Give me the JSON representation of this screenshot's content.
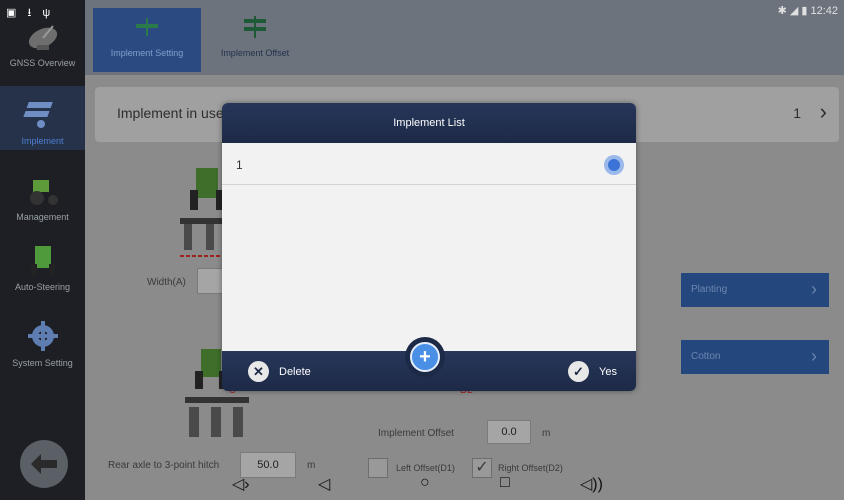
{
  "status_bar": {
    "left_icons": "▣ ⭳ ψ",
    "right_text": "✱ ◢ ▮ 12:42"
  },
  "sidebar": {
    "items": [
      {
        "label": "GNSS Overview",
        "icon": "satellite-dish-icon"
      },
      {
        "label": "Implement",
        "icon": "implement-icon",
        "active": true
      },
      {
        "label": "Management",
        "icon": "tractor-icon"
      },
      {
        "label": "Auto-Steering",
        "icon": "steering-tractor-icon"
      },
      {
        "label": "System Setting",
        "icon": "gear-icon"
      }
    ]
  },
  "tabs": [
    {
      "label": "Implement Setting",
      "active": true
    },
    {
      "label": "Implement Offset",
      "active": false
    }
  ],
  "implement_row": {
    "label": "Implement in use",
    "value": "1"
  },
  "form": {
    "width_label": "Width(A)",
    "planting_label": "Planting",
    "cotton_label": "Cotton",
    "implement_offset_label": "Implement Offset",
    "implement_offset_value": "0.0",
    "implement_offset_unit": "m",
    "rear_axle_label": "Rear axle to 3-point hitch",
    "rear_axle_value": "50.0",
    "rear_axle_unit": "m",
    "left_offset_label": "Left Offset(D1)",
    "right_offset_label": "Right Offset(D2)",
    "offset_tag": "D2"
  },
  "dialog": {
    "title": "Implement List",
    "items": [
      {
        "label": "1",
        "selected": true
      }
    ],
    "delete_label": "Delete",
    "yes_label": "Yes"
  },
  "navbar": {
    "vol_down": "◁›",
    "back": "◁",
    "home": "○",
    "recents": "□",
    "vol_up": "◁))"
  },
  "colors": {
    "accent": "#2c4a82",
    "dialog_header": "#1d2a47",
    "radio": "#3b73d6"
  }
}
